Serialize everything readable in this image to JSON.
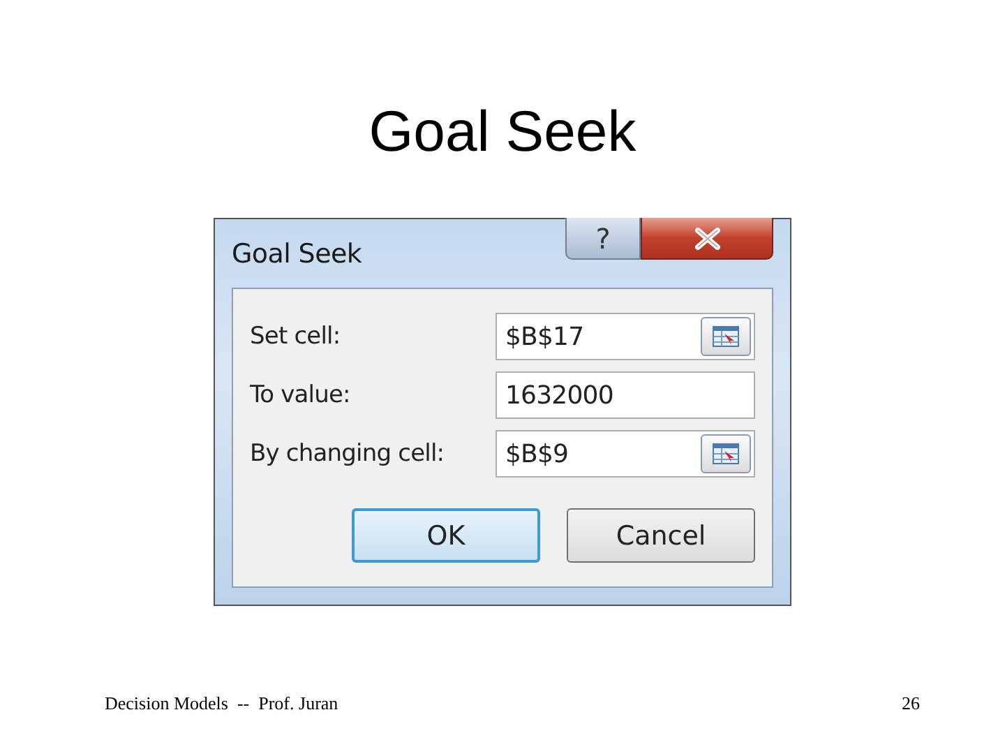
{
  "slide": {
    "title": "Goal Seek",
    "footer_left": "Decision Models  --  Prof. Juran",
    "page_number": "26"
  },
  "dialog": {
    "title": "Goal Seek",
    "help": "?",
    "fields": [
      {
        "label": "Set cell:",
        "value": "$B$17",
        "has_picker": true
      },
      {
        "label": "To value:",
        "value": "1632000",
        "has_picker": false
      },
      {
        "label": "By changing cell:",
        "value": "$B$9",
        "has_picker": true
      }
    ],
    "buttons": [
      {
        "label": "OK",
        "default": true
      },
      {
        "label": "Cancel",
        "default": false
      }
    ]
  }
}
